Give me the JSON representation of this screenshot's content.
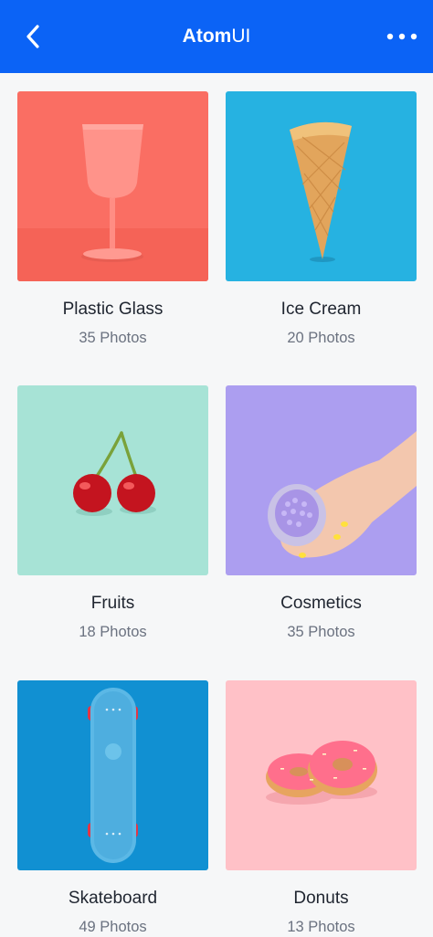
{
  "app_bar": {
    "title_bold": "Atom",
    "title_light": "UI",
    "background": "#0b63f6"
  },
  "items": [
    {
      "title": "Plastic Glass",
      "count": "35 Photos",
      "bg": "#fa6e63"
    },
    {
      "title": "Ice Cream",
      "count": "20 Photos",
      "bg": "#26b2e1"
    },
    {
      "title": "Fruits",
      "count": "18 Photos",
      "bg": "#a7e3d6"
    },
    {
      "title": "Cosmetics",
      "count": "35 Photos",
      "bg": "#ac9ef0"
    },
    {
      "title": "Skateboard",
      "count": "49 Photos",
      "bg": "#1190d2"
    },
    {
      "title": "Donuts",
      "count": "13 Photos",
      "bg": "#ffc1c7"
    }
  ]
}
